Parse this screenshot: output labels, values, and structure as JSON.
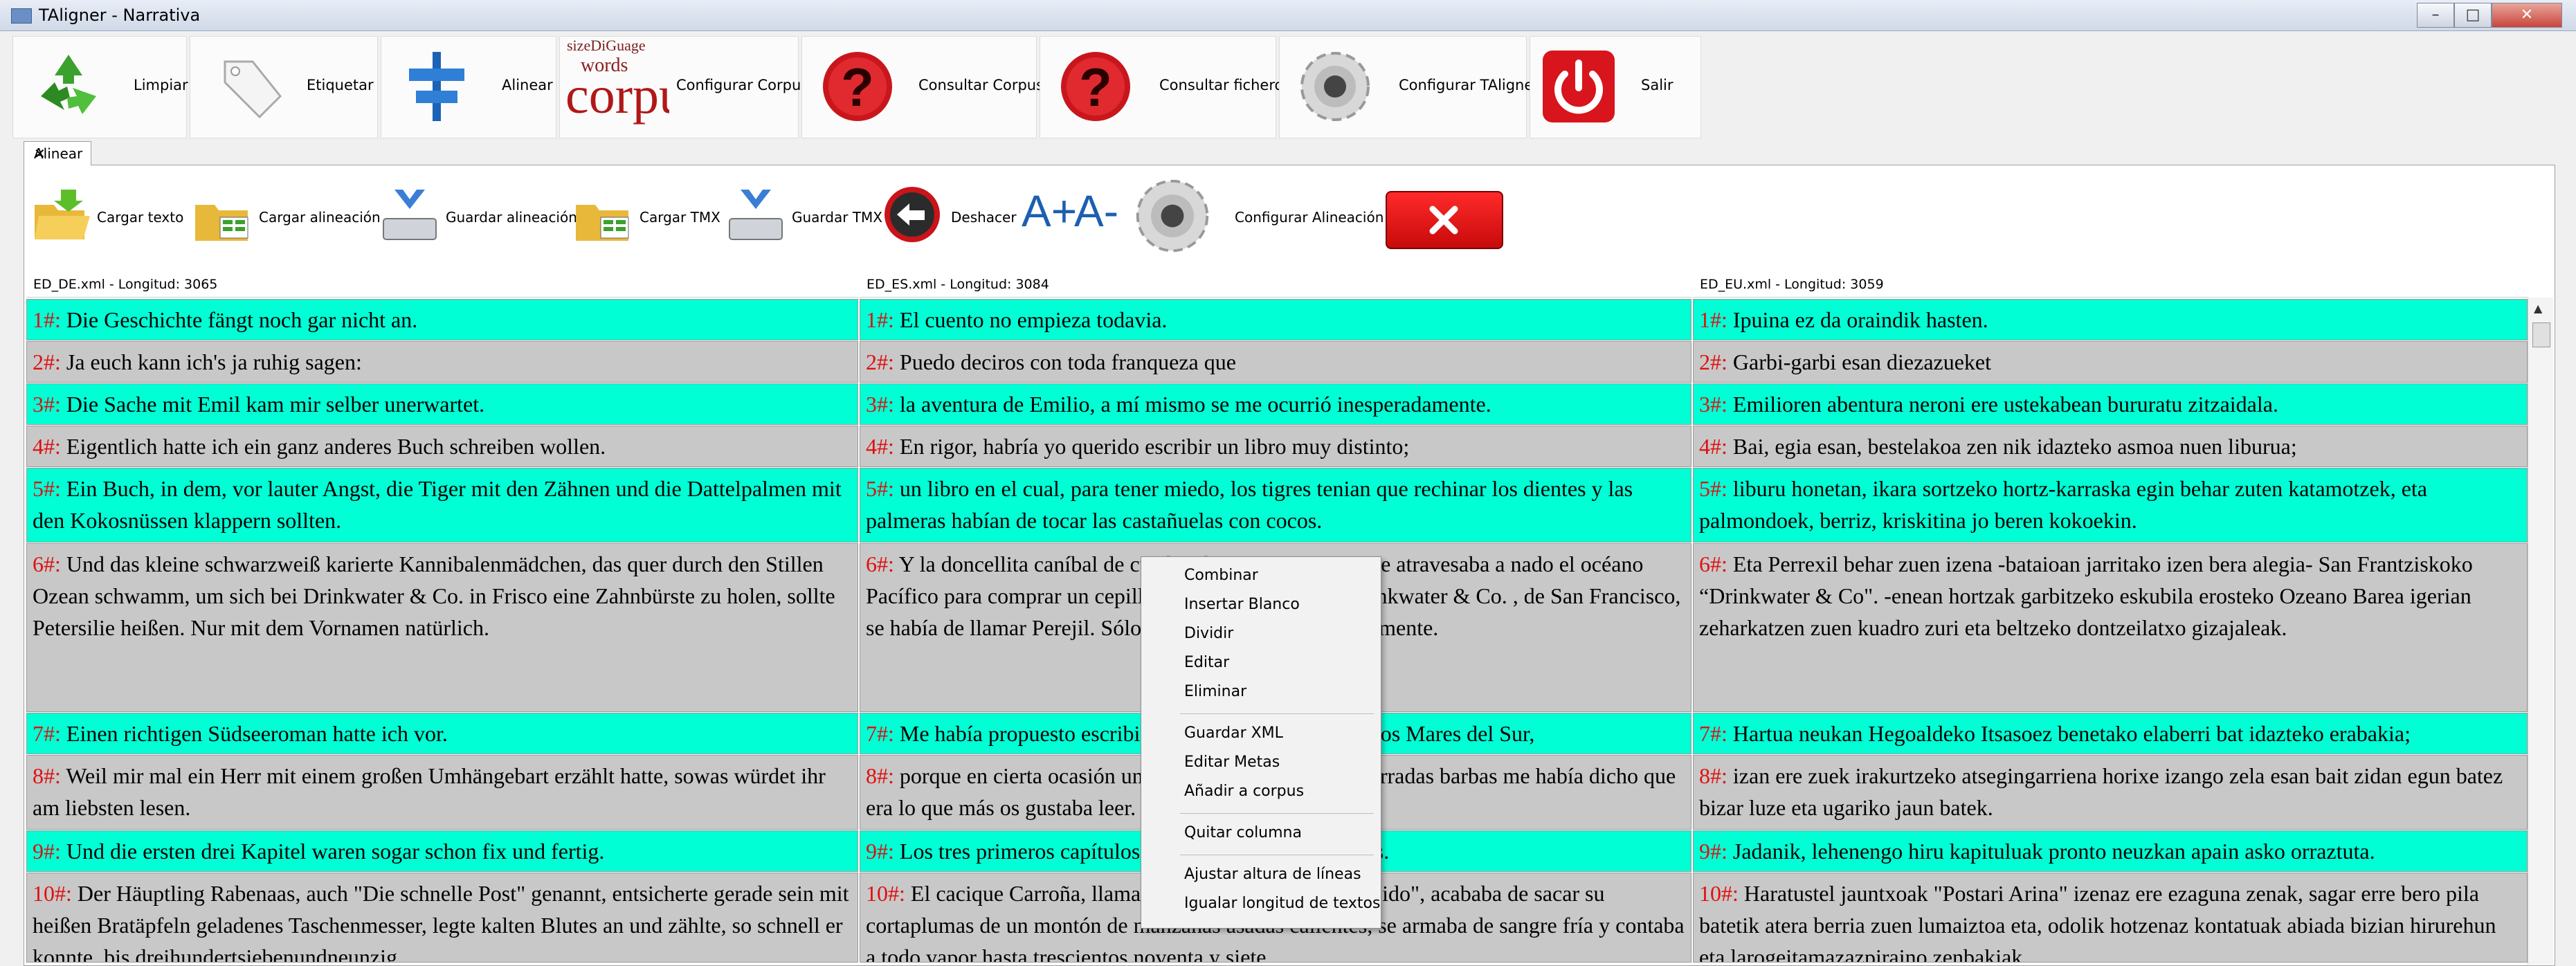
{
  "window": {
    "title": "TAligner - Narrativa",
    "minimize": "–",
    "maximize": "□",
    "close": "✕"
  },
  "main_toolbar": [
    {
      "label": "Limpiar",
      "icon": "recycle-icon"
    },
    {
      "label": "Etiquetar",
      "icon": "tag-icon"
    },
    {
      "label": "Alinear",
      "icon": "align-icon"
    },
    {
      "label": "Configurar Corpus",
      "icon": "corpus-icon"
    },
    {
      "label": "Consultar Corpus",
      "icon": "question-icon"
    },
    {
      "label": "Consultar ficheros",
      "icon": "question-icon"
    },
    {
      "label": "Configurar TAligner",
      "icon": "gear-icon"
    },
    {
      "label": "Salir",
      "icon": "power-icon"
    }
  ],
  "corpus_icon_text": {
    "top": "sizeDiGuage",
    "mid": "words",
    "big": "corpus"
  },
  "tab": {
    "label": "Alinear",
    "close": "✕"
  },
  "align_toolbar": {
    "cargar_texto": "Cargar texto",
    "cargar_alineacion": "Cargar alineación",
    "guardar_alineacion": "Guardar alineación",
    "cargar_tmx": "Cargar TMX",
    "guardar_tmx": "Guardar TMX",
    "deshacer": "Deshacer",
    "font_up": "A+",
    "font_down": "A-",
    "configurar_alineacion": "Configurar Alineación"
  },
  "columns": [
    {
      "header": "ED_DE.xml - Longitud: 3065"
    },
    {
      "header": "ED_ES.xml - Longitud: 3084"
    },
    {
      "header": "ED_EU.xml - Longitud: 3059"
    }
  ],
  "rows": [
    {
      "color": "#00ffd5",
      "de": {
        "n": "1#:",
        "t": " Die Geschichte fängt noch gar nicht an."
      },
      "es": {
        "n": "1#:",
        "t": " El cuento no empieza todavia."
      },
      "eu": {
        "n": "1#:",
        "t": " Ipuina ez da oraindik hasten."
      }
    },
    {
      "color": "#c8c8c8",
      "de": {
        "n": "2#:",
        "t": " Ja euch kann ich's ja ruhig sagen:"
      },
      "es": {
        "n": "2#:",
        "t": " Puedo deciros con toda franqueza que"
      },
      "eu": {
        "n": "2#:",
        "t": " Garbi-garbi esan diezazueket"
      }
    },
    {
      "color": "#00ffd5",
      "de": {
        "n": "3#:",
        "t": " Die Sache mit Emil kam mir selber unerwartet."
      },
      "es": {
        "n": "3#:",
        "t": " la aventura de Emilio, a mí mismo se me ocurrió inesperadamente."
      },
      "eu": {
        "n": "3#:",
        "t": " Emilioren abentura neroni ere ustekabean bururatu zitzaidala."
      }
    },
    {
      "color": "#c8c8c8",
      "de": {
        "n": "4#:",
        "t": " Eigentlich hatte ich ein ganz anderes Buch schreiben wollen."
      },
      "es": {
        "n": "4#:",
        "t": " En rigor, habría yo querido escribir un libro muy distinto;"
      },
      "eu": {
        "n": "4#:",
        "t": " Bai, egia esan, bestelakoa zen nik idazteko asmoa nuen liburua;"
      }
    },
    {
      "color": "#00ffd5",
      "de": {
        "n": "5#:",
        "t": " Ein Buch, in dem, vor lauter Angst, die Tiger mit den Zähnen und die Dattelpalmen mit den Kokosnüssen klappern sollten."
      },
      "es": {
        "n": "5#:",
        "t": " un libro en el cual, para tener miedo, los tigres tenian que rechinar los dientes y las palmeras habían de tocar las castañuelas con cocos."
      },
      "eu": {
        "n": "5#:",
        "t": " liburu honetan, ikara sortzeko hortz-karraska egin behar zuten katamotzek, eta palmondoek, berriz, kriskitina jo beren kokoekin."
      }
    },
    {
      "color": "#c8c8c8",
      "de": {
        "n": "6#:",
        "t": " Und das kleine schwarzweiß karierte Kannibalenmädchen, das quer durch den Stillen Ozean schwamm, um sich bei Drinkwater & Co. in Frisco eine Zahnbürste zu holen, sollte Petersilie heißen. Nur mit dem Vornamen natürlich."
      },
      "es": {
        "n": "6#:",
        "t": " Y la doncellita caníbal de cuadros blancos y negros que atravesaba a nado el océano Pacífico para comprar un cepillo de dientes en la casa Drinkwater & Co. , de San Francisco, se había de llamar Perejil. Sólo de nombre de pila, naturalmente."
      },
      "eu": {
        "n": "6#:",
        "t": " Eta Perrexil behar zuen izena -bataioan jarritako izen bera alegia- San Frantziskoko “Drinkwater & Co\". -enean hortzak garbitzeko eskubila erosteko Ozeano Barea igerian zeharkatzen zuen kuadro zuri eta beltzeko dontzeilatxo gizajaleak."
      }
    },
    {
      "color": "#00ffd5",
      "de": {
        "n": "7#:",
        "t": " Einen richtigen Südseeroman hatte ich vor."
      },
      "es": {
        "n": "7#:",
        "t": " Me había propuesto escribir una verdadera novela de los Mares del Sur,"
      },
      "eu": {
        "n": "7#:",
        "t": " Hartua neukan Hegoaldeko Itsasoez benetako elaberri bat idazteko erabakia;"
      }
    },
    {
      "color": "#c8c8c8",
      "de": {
        "n": "8#:",
        "t": " Weil mir mal ein Herr mit einem großen Umhängebart erzählt hatte, sowas würdet ihr am liebsten lesen."
      },
      "es": {
        "n": "8#:",
        "t": " porque en cierta ocasión un señor con unas grandes cerradas barbas me había dicho que era lo que más os gustaba leer."
      },
      "eu": {
        "n": "8#:",
        "t": " izan ere zuek irakurtzeko atsegingarriena horixe izango zela esan bait zidan egun batez bizar luze eta ugariko jaun batek."
      }
    },
    {
      "color": "#00ffd5",
      "de": {
        "n": "9#:",
        "t": " Und die ersten drei Kapitel waren sogar schon fix und fertig."
      },
      "es": {
        "n": "9#:",
        "t": " Los tres primeros capítulos estaban ya hasta perfilados."
      },
      "eu": {
        "n": "9#:",
        "t": " Jadanik, lehenengo hiru kapituluak pronto neuzkan apain asko orraztuta."
      }
    },
    {
      "color": "#c8c8c8",
      "de": {
        "n": "10#:",
        "t": " Der Häuptling Rabenaas, auch \"Die schnelle Post\" genannt, entsicherte gerade sein mit heißen Bratäpfeln geladenes Taschenmesser, legte kalten Blutes an und zählte, so schnell er konnte, bis dreihundertsiebenundneunzig... ."
      },
      "es": {
        "n": "10#:",
        "t": " El cacique Carroña, llamado también \"El Correo Rápido\", acababa de sacar su cortaplumas de un montón de manzanas asadas calientes, se armaba de sangre fría y contaba a todo vapor hasta trescientos noventa y siete... ."
      },
      "eu": {
        "n": "10#:",
        "t": " Haratustel jauntxoak \"Postari Arina\" izenaz ere ezaguna zenak, sagar erre bero pila batetik atera berria zuen lumaiztoa eta, odolik hotzenaz kontatuak abiada bizian hirurehun eta larogeitamazazpiraino zenbakiak... ."
      }
    }
  ],
  "context_menu": {
    "group1": [
      "Combinar",
      "Insertar Blanco",
      "Dividir",
      "Editar",
      "Eliminar"
    ],
    "group2": [
      "Guardar XML",
      "Editar Metas",
      "Añadir a corpus"
    ],
    "group3": [
      "Quitar columna"
    ],
    "group4": [
      "Ajustar altura de líneas",
      "Igualar longitud de textos"
    ]
  }
}
